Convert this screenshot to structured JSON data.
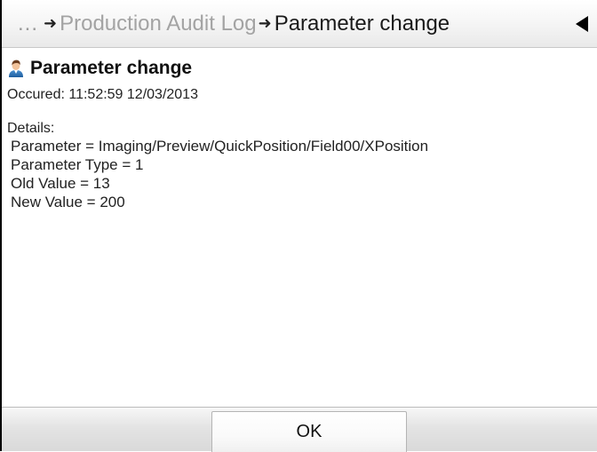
{
  "breadcrumb": {
    "ellipsis": "...",
    "arrow": "➜",
    "items": [
      "Production Audit Log",
      "Parameter change"
    ]
  },
  "header": {
    "back_icon": "triangle-left-icon"
  },
  "event": {
    "user_icon": "user-icon",
    "title": "Parameter change",
    "occured": "Occured: 11:52:59 12/03/2013",
    "details_label": "Details:",
    "details": [
      "Parameter = Imaging/Preview/QuickPosition/Field00/XPosition",
      "Parameter Type = 1",
      "Old Value = 13",
      "New Value = 200"
    ]
  },
  "footer": {
    "ok_label": "OK"
  },
  "colors": {
    "breadcrumb_inactive": "#a3a3a3",
    "breadcrumb_active": "#1a1a1a",
    "text": "#222222"
  }
}
